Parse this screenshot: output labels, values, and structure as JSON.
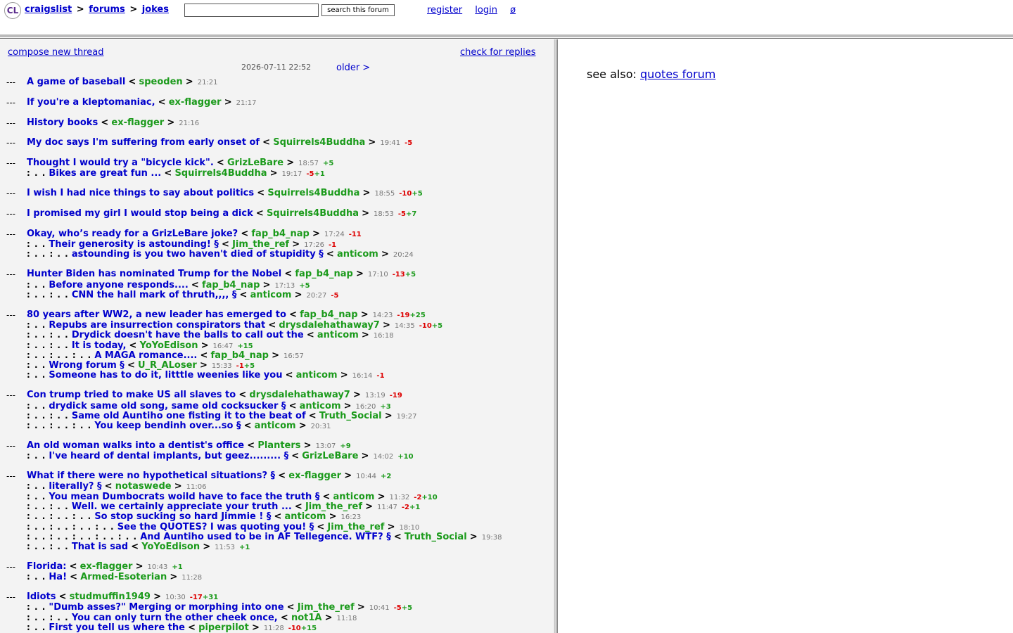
{
  "header": {
    "logo": "CL",
    "crumbs": [
      "craigslist",
      "forums",
      "jokes"
    ],
    "crumb_sep": ">",
    "search_placeholder": "",
    "search_button": "search this forum",
    "links": [
      "register",
      "login",
      "ø"
    ]
  },
  "left": {
    "compose": "compose new thread",
    "check": "check for replies",
    "date": "2026-07-11 22:52",
    "older": "older >"
  },
  "right": {
    "see_also_label": "see also:",
    "see_also_link": "quotes forum"
  },
  "threads": [
    {
      "rows": [
        {
          "indent": "",
          "title": "A game of baseball",
          "author": "speoden",
          "time": "21:21",
          "neg": "",
          "pos": ""
        }
      ]
    },
    {
      "rows": [
        {
          "indent": "",
          "title": "If you're a kleptomaniac,",
          "author": "ex-flagger",
          "time": "21:17",
          "neg": "",
          "pos": ""
        }
      ]
    },
    {
      "rows": [
        {
          "indent": "",
          "title": "History books",
          "author": "ex-flagger",
          "time": "21:16",
          "neg": "",
          "pos": ""
        }
      ]
    },
    {
      "rows": [
        {
          "indent": "",
          "title": "My doc says I'm suffering from early onset of",
          "author": "Squirrels4Buddha",
          "time": "19:41",
          "neg": "-5",
          "pos": ""
        }
      ]
    },
    {
      "rows": [
        {
          "indent": "",
          "title": "Thought I would try a \"bicycle kick\".",
          "author": "GrizLeBare",
          "time": "18:57",
          "neg": "",
          "pos": "+5"
        },
        {
          "indent": ": . .",
          "title": "Bikes are great fun ...",
          "author": "Squirrels4Buddha",
          "time": "19:17",
          "neg": "-5",
          "pos": "+1"
        }
      ]
    },
    {
      "rows": [
        {
          "indent": "",
          "title": "I wish I had nice things to say about politics",
          "author": "Squirrels4Buddha",
          "time": "18:55",
          "neg": "-10",
          "pos": "+5"
        }
      ]
    },
    {
      "rows": [
        {
          "indent": "",
          "title": "I promised my girl I would stop being a dick",
          "author": "Squirrels4Buddha",
          "time": "18:53",
          "neg": "-5",
          "pos": "+7"
        }
      ]
    },
    {
      "rows": [
        {
          "indent": "",
          "title": "Okay, who’s ready for a GrizLeBare joke?",
          "author": "fap_b4_nap",
          "time": "17:24",
          "neg": "-11",
          "pos": ""
        },
        {
          "indent": ": . .",
          "title": "Their generosity is astounding! §",
          "author": "Jim_the_ref",
          "time": "17:26",
          "neg": "-1",
          "pos": ""
        },
        {
          "indent": ": . . : . .",
          "title": "astounding is you two haven't died of stupidity §",
          "author": "anticom",
          "time": "20:24",
          "neg": "",
          "pos": ""
        }
      ]
    },
    {
      "rows": [
        {
          "indent": "",
          "title": "Hunter Biden has nominated Trump for the Nobel",
          "author": "fap_b4_nap",
          "time": "17:10",
          "neg": "-13",
          "pos": "+5"
        },
        {
          "indent": ": . .",
          "title": "Before anyone responds....",
          "author": "fap_b4_nap",
          "time": "17:13",
          "neg": "",
          "pos": "+5"
        },
        {
          "indent": ": . . : . .",
          "title": "CNN the hall mark of thruth,,,, §",
          "author": "anticom",
          "time": "20:27",
          "neg": "-5",
          "pos": ""
        }
      ]
    },
    {
      "rows": [
        {
          "indent": "",
          "title": "80 years after WW2, a new leader has emerged to",
          "author": "fap_b4_nap",
          "time": "14:23",
          "neg": "-19",
          "pos": "+25"
        },
        {
          "indent": ": . .",
          "title": "Repubs are insurrection conspirators that",
          "author": "drysdalehathaway7",
          "time": "14:35",
          "neg": "-10",
          "pos": "+5"
        },
        {
          "indent": ": . . : . .",
          "title": "Drydick doesn't have the balls to call out the",
          "author": "anticom",
          "time": "16:18",
          "neg": "",
          "pos": ""
        },
        {
          "indent": ": . . : . .",
          "title": "It is today,",
          "author": "YoYoEdison",
          "time": "16:47",
          "neg": "",
          "pos": "+15"
        },
        {
          "indent": ": . . : . . : . .",
          "title": "A MAGA romance....",
          "author": "fap_b4_nap",
          "time": "16:57",
          "neg": "",
          "pos": ""
        },
        {
          "indent": ": . .",
          "title": "Wrong forum §",
          "author": "U_R_ALoser",
          "time": "15:33",
          "neg": "-1",
          "pos": "+5"
        },
        {
          "indent": ": . .",
          "title": "Someone has to do it, litttle weenies like you",
          "author": "anticom",
          "time": "16:14",
          "neg": "-1",
          "pos": ""
        }
      ]
    },
    {
      "rows": [
        {
          "indent": "",
          "title": "Con trump tried to make US all slaves to",
          "author": "drysdalehathaway7",
          "time": "13:19",
          "neg": "-19",
          "pos": ""
        },
        {
          "indent": ": . .",
          "title": "drydick same old song, same old cocksucker §",
          "author": "anticom",
          "time": "16:20",
          "neg": "",
          "pos": "+3"
        },
        {
          "indent": ": . . : . .",
          "title": "Same old Auntiho one fisting it to the beat of",
          "author": "Truth_Social",
          "time": "19:27",
          "neg": "",
          "pos": ""
        },
        {
          "indent": ": . . : . . : . .",
          "title": "You keep bendinh over...so §",
          "author": "anticom",
          "time": "20:31",
          "neg": "",
          "pos": ""
        }
      ]
    },
    {
      "rows": [
        {
          "indent": "",
          "title": "An old woman walks into a dentist's office",
          "author": "Planters",
          "time": "13:07",
          "neg": "",
          "pos": "+9"
        },
        {
          "indent": ": . .",
          "title": "I've heard of dental implants, but geez......... §",
          "author": "GrizLeBare",
          "time": "14:02",
          "neg": "",
          "pos": "+10"
        }
      ]
    },
    {
      "rows": [
        {
          "indent": "",
          "title": "What if there were no hypothetical situations? §",
          "author": "ex-flagger",
          "time": "10:44",
          "neg": "",
          "pos": "+2"
        },
        {
          "indent": ": . .",
          "title": "literally? §",
          "author": "notaswede",
          "time": "11:06",
          "neg": "",
          "pos": ""
        },
        {
          "indent": ": . .",
          "title": "You mean Dumbocrats woild have to face the truth §",
          "author": "anticom",
          "time": "11:32",
          "neg": "-2",
          "pos": "+10"
        },
        {
          "indent": ": . . : . .",
          "title": "Well. we certainly appreciate your truth ...",
          "author": "Jim_the_ref",
          "time": "11:47",
          "neg": "-2",
          "pos": "+1"
        },
        {
          "indent": ": . . : . . : . .",
          "title": "So stop sucking so hard Jimmie ! §",
          "author": "anticom",
          "time": "16:23",
          "neg": "",
          "pos": ""
        },
        {
          "indent": ": . . : . . : . . : . .",
          "title": "See the QUOTES? I was quoting you! §",
          "author": "Jim_the_ref",
          "time": "18:10",
          "neg": "",
          "pos": ""
        },
        {
          "indent": ": . . : . . : . . : . . : . .",
          "title": "And Auntiho used to be in AF Tellegence. WTF? §",
          "author": "Truth_Social",
          "time": "19:38",
          "neg": "",
          "pos": ""
        },
        {
          "indent": ": . . : . .",
          "title": "That is sad",
          "author": "YoYoEdison",
          "time": "11:53",
          "neg": "",
          "pos": "+1"
        }
      ]
    },
    {
      "rows": [
        {
          "indent": "",
          "title": "Florida:",
          "author": "ex-flagger",
          "time": "10:43",
          "neg": "",
          "pos": "+1"
        },
        {
          "indent": ": . .",
          "title": "Ha!",
          "author": "Armed-Esoterian",
          "time": "11:28",
          "neg": "",
          "pos": ""
        }
      ]
    },
    {
      "rows": [
        {
          "indent": "",
          "title": "Idiots",
          "author": "studmuffin1949",
          "time": "10:30",
          "neg": "-17",
          "pos": "+31"
        },
        {
          "indent": ": . .",
          "title": "\"Dumb asses?\" Merging or morphing into one",
          "author": "Jim_the_ref",
          "time": "10:41",
          "neg": "-5",
          "pos": "+5"
        },
        {
          "indent": ": . . : . .",
          "title": "You can only turn the other cheek once,",
          "author": "not1A",
          "time": "11:18",
          "neg": "",
          "pos": ""
        },
        {
          "indent": ": . .",
          "title": "First you tell us where the",
          "author": "piperpilot",
          "time": "11:28",
          "neg": "-10",
          "pos": "+15"
        }
      ]
    }
  ]
}
